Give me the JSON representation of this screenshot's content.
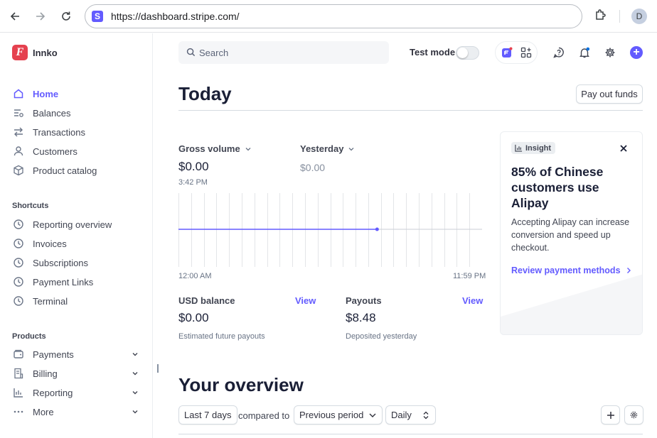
{
  "browser": {
    "url": "https://dashboard.stripe.com/",
    "profile_initial": "D"
  },
  "brand": {
    "logo_letter": "F",
    "name": "Innko"
  },
  "sidebar": {
    "main": [
      {
        "label": "Home",
        "icon": "home-icon",
        "active": true
      },
      {
        "label": "Balances",
        "icon": "balances-icon"
      },
      {
        "label": "Transactions",
        "icon": "transactions-icon"
      },
      {
        "label": "Customers",
        "icon": "customers-icon"
      },
      {
        "label": "Product catalog",
        "icon": "product-catalog-icon"
      }
    ],
    "shortcuts_label": "Shortcuts",
    "shortcuts": [
      {
        "label": "Reporting overview",
        "icon": "clock-icon"
      },
      {
        "label": "Invoices",
        "icon": "clock-icon"
      },
      {
        "label": "Subscriptions",
        "icon": "clock-icon"
      },
      {
        "label": "Payment Links",
        "icon": "clock-icon"
      },
      {
        "label": "Terminal",
        "icon": "clock-icon"
      }
    ],
    "products_label": "Products",
    "products": [
      {
        "label": "Payments",
        "icon": "payments-icon"
      },
      {
        "label": "Billing",
        "icon": "billing-icon"
      },
      {
        "label": "Reporting",
        "icon": "reporting-icon"
      },
      {
        "label": "More",
        "icon": "more-icon"
      }
    ]
  },
  "header": {
    "search_placeholder": "Search",
    "test_mode_label": "Test mode",
    "test_mode_on": false
  },
  "today": {
    "title": "Today",
    "payout_button": "Pay out funds",
    "gross_volume_label": "Gross volume",
    "gross_volume_value": "$0.00",
    "time_label": "3:42 PM",
    "yesterday_label": "Yesterday",
    "yesterday_value": "$0.00",
    "chart_start": "12:00 AM",
    "chart_end": "11:59 PM",
    "usd_balance_label": "USD balance",
    "usd_balance_view": "View",
    "usd_balance_value": "$0.00",
    "usd_balance_sub": "Estimated future payouts",
    "payouts_label": "Payouts",
    "payouts_view": "View",
    "payouts_value": "$8.48",
    "payouts_sub": "Deposited yesterday"
  },
  "insight": {
    "badge": "Insight",
    "title": "85% of Chinese customers use Alipay",
    "body": "Accepting Alipay can increase conversion and speed up checkout.",
    "link": "Review payment methods"
  },
  "overview": {
    "title": "Your overview",
    "range": "Last 7 days",
    "compared_to": "compared to",
    "comparison": "Previous period",
    "interval": "Daily"
  },
  "colors": {
    "accent": "#635bff",
    "brand": "#e5414f"
  }
}
